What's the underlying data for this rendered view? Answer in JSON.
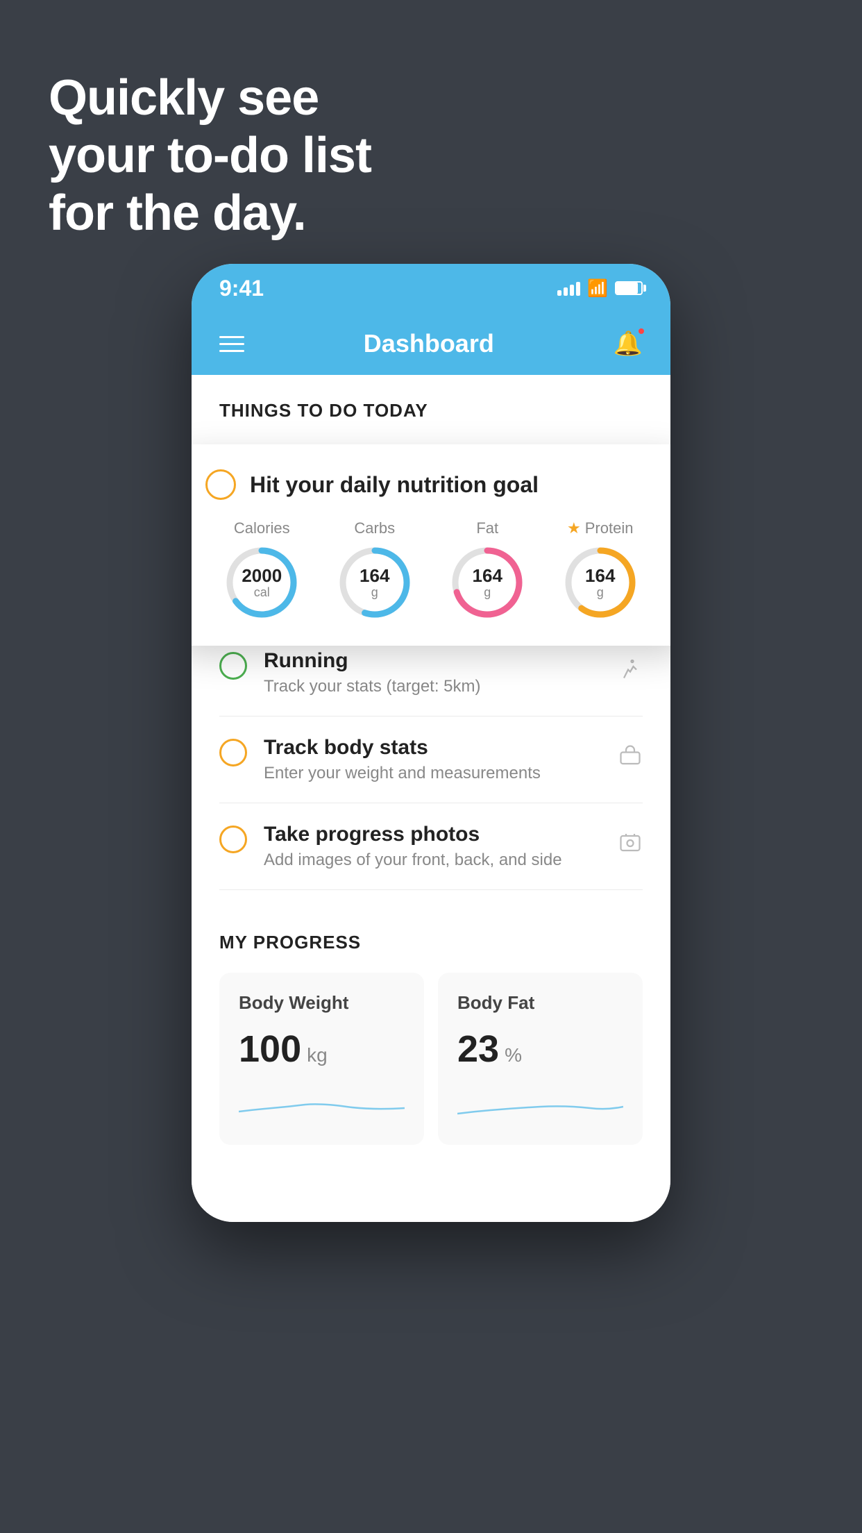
{
  "background": {
    "color": "#3a3f47"
  },
  "headline": {
    "line1": "Quickly see",
    "line2": "your to-do list",
    "line3": "for the day."
  },
  "statusBar": {
    "time": "9:41"
  },
  "navBar": {
    "title": "Dashboard"
  },
  "thingsTodo": {
    "sectionTitle": "THINGS TO DO TODAY",
    "floatingCard": {
      "title": "Hit your daily nutrition goal",
      "items": [
        {
          "label": "Calories",
          "value": "2000",
          "unit": "cal",
          "color": "#4db8e8",
          "percent": 65,
          "starred": false
        },
        {
          "label": "Carbs",
          "value": "164",
          "unit": "g",
          "color": "#4db8e8",
          "percent": 55,
          "starred": false
        },
        {
          "label": "Fat",
          "value": "164",
          "unit": "g",
          "color": "#f06292",
          "percent": 70,
          "starred": false
        },
        {
          "label": "Protein",
          "value": "164",
          "unit": "g",
          "color": "#f5a623",
          "percent": 60,
          "starred": true
        }
      ]
    },
    "todoItems": [
      {
        "id": "running",
        "title": "Running",
        "subtitle": "Track your stats (target: 5km)",
        "circleColor": "green",
        "icon": "👟"
      },
      {
        "id": "body-stats",
        "title": "Track body stats",
        "subtitle": "Enter your weight and measurements",
        "circleColor": "yellow",
        "icon": "⚖"
      },
      {
        "id": "progress-photos",
        "title": "Take progress photos",
        "subtitle": "Add images of your front, back, and side",
        "circleColor": "yellow",
        "icon": "🖼"
      }
    ]
  },
  "myProgress": {
    "sectionTitle": "MY PROGRESS",
    "cards": [
      {
        "id": "body-weight",
        "title": "Body Weight",
        "value": "100",
        "unit": "kg"
      },
      {
        "id": "body-fat",
        "title": "Body Fat",
        "value": "23",
        "unit": "%"
      }
    ]
  }
}
